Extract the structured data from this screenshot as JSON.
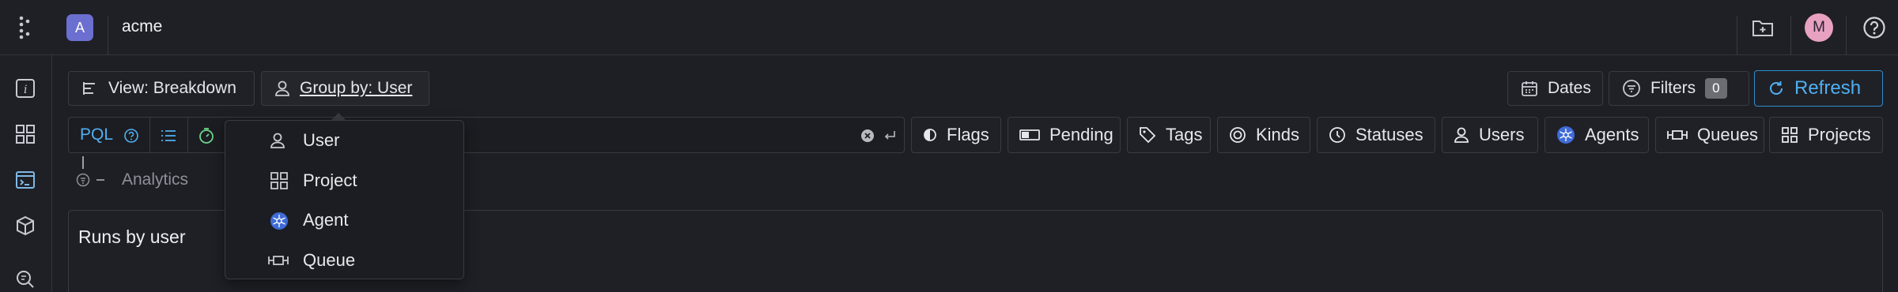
{
  "org": {
    "initial": "A",
    "name": "acme"
  },
  "user": {
    "initial": "M"
  },
  "toolbar": {
    "view_label": "View: Breakdown",
    "group_label": "Group by: User",
    "dates_label": "Dates",
    "filters_label": "Filters",
    "filters_count": "0",
    "refresh_label": "Refresh"
  },
  "search": {
    "pql_label": "PQL"
  },
  "filter_chips": [
    "Flags",
    "Pending",
    "Tags",
    "Kinds",
    "Statuses",
    "Users",
    "Agents",
    "Queues",
    "Projects"
  ],
  "analytics_label": "Analytics",
  "panel": {
    "title": "Runs by user"
  },
  "group_menu": {
    "items": [
      {
        "label": "User",
        "icon": "user-icon"
      },
      {
        "label": "Project",
        "icon": "grid-icon"
      },
      {
        "label": "Agent",
        "icon": "agent-icon"
      },
      {
        "label": "Queue",
        "icon": "queue-icon"
      }
    ]
  },
  "colors": {
    "accent": "#4fb0f2",
    "org_badge": "#6b6fcf",
    "avatar": "#e8a1c0"
  }
}
